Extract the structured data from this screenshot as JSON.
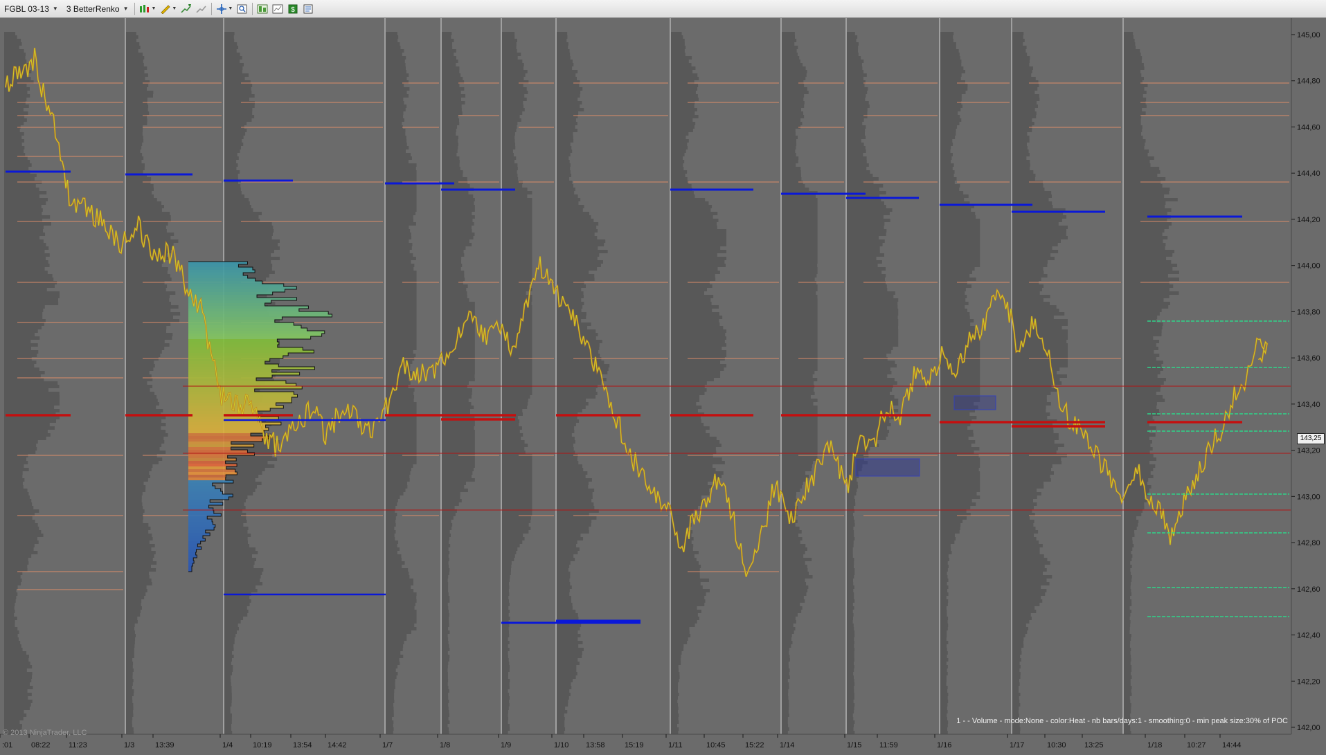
{
  "toolbar": {
    "instrument": "FGBL 03-13",
    "bar_type": "3 BetterRenko",
    "icons": [
      "bar-style-icon",
      "drawing-pencil-icon",
      "add-indicator-icon",
      "remove-icon",
      "crosshair-icon",
      "zoom-icon",
      "data-box-icon",
      "chart-properties-icon",
      "strategy-icon",
      "window-properties-icon"
    ]
  },
  "chart": {
    "price_axis": {
      "labels": [
        "145,00",
        "144,80",
        "144,60",
        "144,40",
        "144,20",
        "144,00",
        "143,80",
        "143,60",
        "143,40",
        "143,20",
        "143,00",
        "142,80",
        "142,60",
        "142,40",
        "142,20",
        "142,00"
      ],
      "range": [
        141.99,
        145.07
      ]
    },
    "current_price": "143,25",
    "time_axis": {
      "labels": [
        ":01",
        "08:22",
        "11:23",
        "1/3",
        "13:39",
        "1/4",
        "10:19",
        "13:54",
        "14:42",
        "1/7",
        "1/8",
        "1/9",
        "1/10",
        "13:58",
        "15:19",
        "1/11",
        "10:45",
        "15:22",
        "1/14",
        "1/15",
        "11:59",
        "1/16",
        "1/17",
        "10:30",
        "13:25",
        "1/18",
        "10:27",
        "14:44"
      ]
    },
    "indicator_text": "1 -   - Volume - mode:None - color:Heat - nb bars/days:1 - smoothing:0 - min peak size:30% of POC",
    "copyright": "© 2013 NinjaTrader, LLC",
    "colors": {
      "background": "#6b6b6b",
      "session_profile": "#585858",
      "session_separator": "#d4d4d4",
      "value_area_high_low": "#0a18d8",
      "poc": "#c40f0f",
      "peak_lines": "#e8906a",
      "today_lines": "#2ed68a"
    }
  }
}
